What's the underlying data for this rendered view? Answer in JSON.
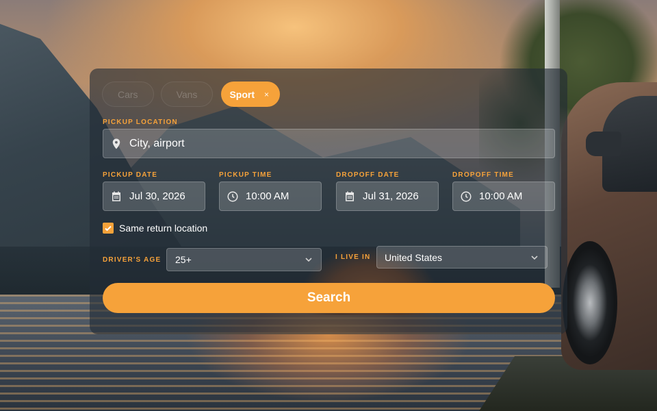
{
  "tabs": [
    {
      "label": "Cars",
      "active": false
    },
    {
      "label": "Vans",
      "active": false
    },
    {
      "label": "Sport",
      "active": true,
      "close_label": "×"
    }
  ],
  "pickup_location": {
    "label": "PICKUP LOCATION",
    "value": "City, airport",
    "icon": "map-pin-icon"
  },
  "pickup_date": {
    "label": "PICKUP DATE",
    "value": "Jul 30, 2026",
    "icon": "calendar-icon"
  },
  "pickup_time": {
    "label": "PICKUP TIME",
    "value": "10:00 AM",
    "icon": "clock-icon"
  },
  "dropoff_date": {
    "label": "DROPOFF DATE",
    "value": "Jul 31, 2026",
    "icon": "calendar-icon"
  },
  "dropoff_time": {
    "label": "DROPOFF TIME",
    "value": "10:00 AM",
    "icon": "clock-icon"
  },
  "same_return": {
    "label": "Same return location",
    "checked": true
  },
  "drivers_age": {
    "label": "DRIVER'S AGE",
    "value": "25+"
  },
  "country": {
    "label": "I LIVE IN",
    "value": "United States"
  },
  "search_button": {
    "label": "Search"
  },
  "colors": {
    "accent": "#f6a23a",
    "panel": "#222c36"
  }
}
